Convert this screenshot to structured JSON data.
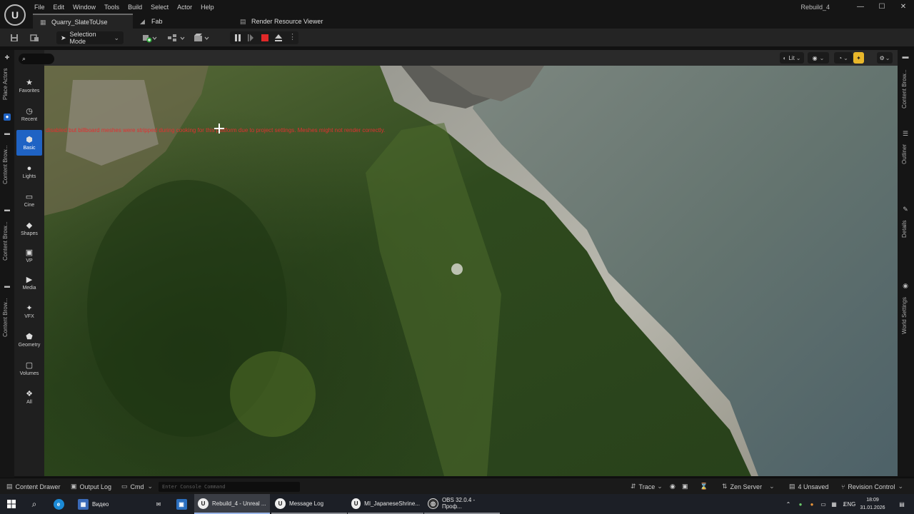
{
  "window": {
    "title": "Rebuild_4",
    "controls": [
      "—",
      "☐",
      "✕"
    ]
  },
  "menu": [
    "File",
    "Edit",
    "Window",
    "Tools",
    "Build",
    "Select",
    "Actor",
    "Help"
  ],
  "tabs": [
    {
      "label": "Quarry_SlateToUse"
    },
    {
      "label": "Fab"
    },
    {
      "label": "Render Resource Viewer"
    }
  ],
  "toolbar": {
    "selection_mode": "Selection Mode"
  },
  "left_rail": {
    "place_actors": "Place Actors",
    "content_browser_tabs": [
      "Content Brow...",
      "Content Brow...",
      "Content Brow..."
    ]
  },
  "place_panel": {
    "categories": [
      {
        "label": "Favorites",
        "icon": "star-icon"
      },
      {
        "label": "Recent",
        "icon": "clock-icon"
      },
      {
        "label": "Basic",
        "icon": "basic-icon"
      },
      {
        "label": "Lights",
        "icon": "light-icon"
      },
      {
        "label": "Cine",
        "icon": "cine-icon"
      },
      {
        "label": "Shapes",
        "icon": "shapes-icon"
      },
      {
        "label": "VP",
        "icon": "vp-icon"
      },
      {
        "label": "Media",
        "icon": "media-icon"
      },
      {
        "label": "VFX",
        "icon": "vfx-icon"
      },
      {
        "label": "Geometry",
        "icon": "geometry-icon"
      },
      {
        "label": "Volumes",
        "icon": "volumes-icon"
      },
      {
        "label": "All",
        "icon": "all-icon"
      }
    ],
    "selected": "Basic"
  },
  "viewport": {
    "view_mode": "Lit",
    "warning": "disabled but billboard meshes were stripped during cooking for this platform due to project settings. Meshes might not render correctly."
  },
  "right_rail": {
    "tabs": [
      "Content Brow...",
      "Outliner",
      "Details",
      "World Settings"
    ]
  },
  "status_bar": {
    "content_drawer": "Content Drawer",
    "output_log": "Output Log",
    "cmd": "Cmd",
    "console_placeholder": "Enter Console Command",
    "trace": "Trace",
    "zen_server": "Zen Server",
    "unsaved": "4 Unsaved",
    "revision_control": "Revision Control"
  },
  "taskbar": {
    "items": [
      {
        "label": "Видео"
      },
      {
        "label": "Rebuild_4 - Unreal ..."
      },
      {
        "label": "Message Log"
      },
      {
        "label": "MI_JapaneseShrine..."
      },
      {
        "label": "OBS 32.0.4 - Проф..."
      }
    ],
    "language": "ENG",
    "time": "18:09",
    "date": "31.01.2026"
  },
  "colors": {
    "accent": "#1f63c4",
    "warning": "#e03030",
    "stop_button": "#e02828",
    "realtime_toggle": "#e9b72a"
  }
}
